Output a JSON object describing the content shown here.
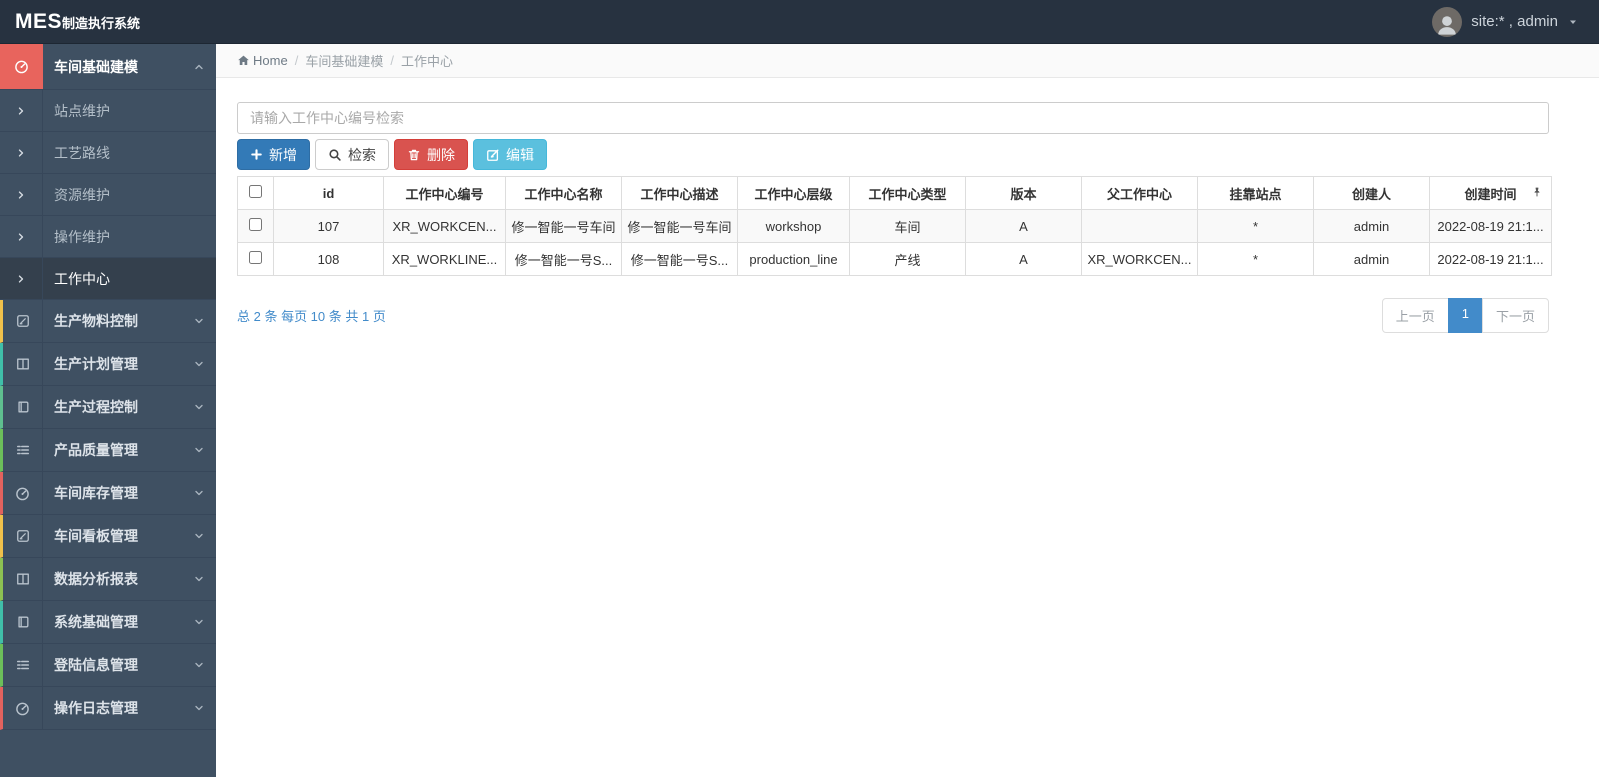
{
  "navbar": {
    "brand_primary": "MES",
    "brand_secondary": "制造执行系统",
    "user_label": "site:* , admin",
    "user_caret_icon": "caret-down-icon",
    "avatar_icon": "user-icon"
  },
  "breadcrumb": {
    "home_icon": "home-icon",
    "home_label": "Home",
    "separator": "/",
    "items": [
      "车间基础建模",
      "工作中心"
    ]
  },
  "sidebar": {
    "group": {
      "label": "车间基础建模",
      "icon": "gauge-icon",
      "icon_bg": "#e8645d",
      "expand_icon": "chevron-up-icon"
    },
    "submenu_arrow_icon": "chevron-right-icon",
    "submenu": [
      {
        "label": "站点维护"
      },
      {
        "label": "工艺路线"
      },
      {
        "label": "资源维护"
      },
      {
        "label": "操作维护"
      },
      {
        "label": "工作中心"
      }
    ],
    "active_submenu": "工作中心",
    "expand_icon": "chevron-down-icon",
    "items": [
      {
        "label": "生产物料控制",
        "icon": "pencil-square-icon",
        "strip": "#f0c14b"
      },
      {
        "label": "生产计划管理",
        "icon": "columns-icon",
        "strip": "#40bfa9"
      },
      {
        "label": "生产过程控制",
        "icon": "book-icon",
        "strip": "#5fbf8f"
      },
      {
        "label": "产品质量管理",
        "icon": "list-icon",
        "strip": "#6cbf5a"
      },
      {
        "label": "车间库存管理",
        "icon": "gauge-icon",
        "strip": "#e2625e"
      },
      {
        "label": "车间看板管理",
        "icon": "pencil-square-icon",
        "strip": "#f0c14b"
      },
      {
        "label": "数据分析报表",
        "icon": "columns-icon",
        "strip": "#8cc152"
      },
      {
        "label": "系统基础管理",
        "icon": "book-icon",
        "strip": "#40bfa9"
      },
      {
        "label": "登陆信息管理",
        "icon": "list-icon",
        "strip": "#6cbf5a"
      },
      {
        "label": "操作日志管理",
        "icon": "gauge-icon",
        "strip": "#e2625e"
      }
    ]
  },
  "toolbar": {
    "search_placeholder": "请输入工作中心编号检索",
    "add_label": "新增",
    "add_icon": "plus-icon",
    "search_label": "检索",
    "search_icon": "search-icon",
    "delete_label": "删除",
    "delete_icon": "trash-icon",
    "edit_label": "编辑",
    "edit_icon": "edit-icon"
  },
  "table": {
    "pin_icon": "pin-icon",
    "headers": [
      "id",
      "工作中心编号",
      "工作中心名称",
      "工作中心描述",
      "工作中心层级",
      "工作中心类型",
      "版本",
      "父工作中心",
      "挂靠站点",
      "创建人",
      "创建时间"
    ],
    "rows": [
      [
        "107",
        "XR_WORKCEN...",
        "修一智能一号车间",
        "修一智能一号车间",
        "workshop",
        "车间",
        "A",
        "",
        "*",
        "admin",
        "2022-08-19 21:1..."
      ],
      [
        "108",
        "XR_WORKLINE...",
        "修一智能一号S...",
        "修一智能一号S...",
        "production_line",
        "产线",
        "A",
        "XR_WORKCEN...",
        "*",
        "admin",
        "2022-08-19 21:1..."
      ]
    ]
  },
  "summary": {
    "text": "总 2 条 每页 10 条 共 1 页"
  },
  "pagination": {
    "prev": "上一页",
    "current": "1",
    "next": "下一页"
  },
  "colors": {
    "navbar_bg": "#273240",
    "sidebar_bg": "#3f5062",
    "sidebar_active_bg": "#34404d",
    "group_icon_bg": "#e8645d",
    "primary_button": "#337ab7",
    "danger_button": "#d9534f",
    "info_button": "#5bc0de",
    "pagination_active": "#428bca",
    "link_blue": "#428bca"
  }
}
